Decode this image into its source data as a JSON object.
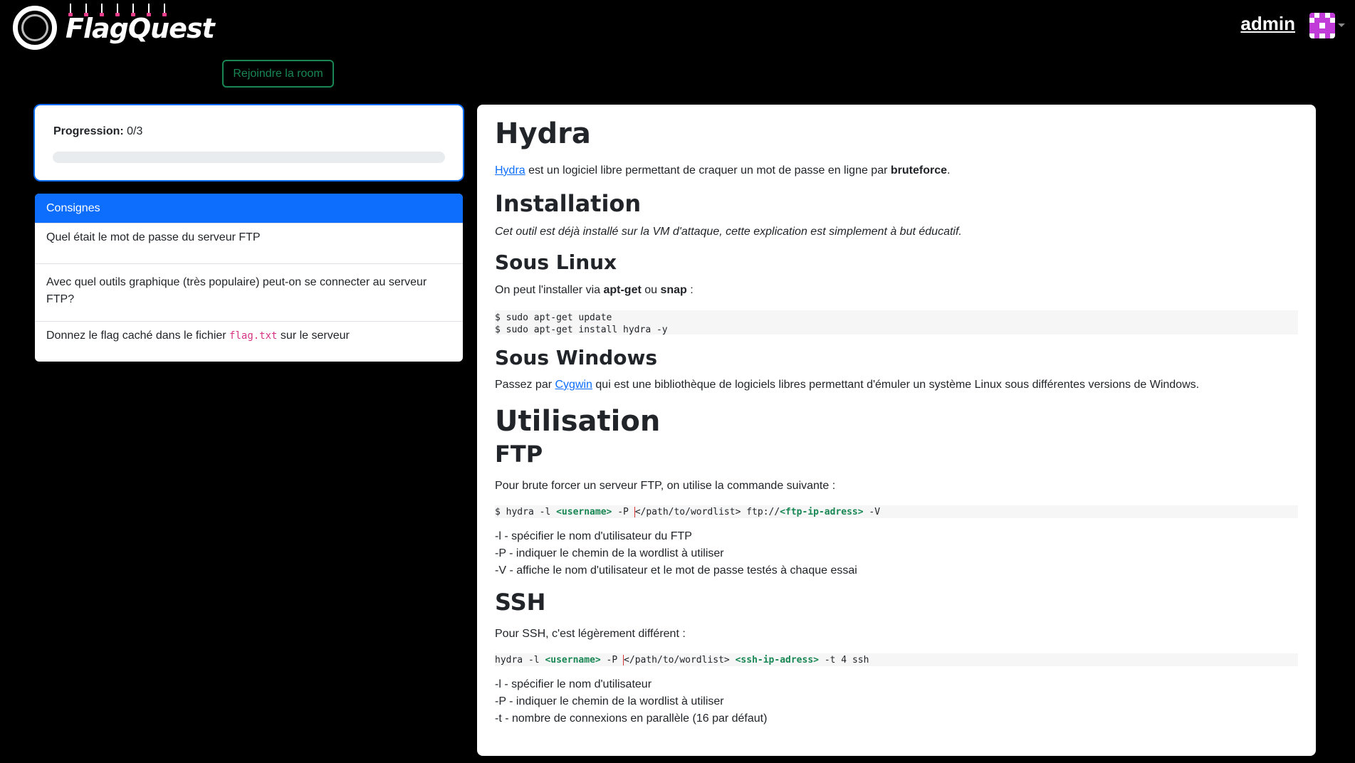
{
  "header": {
    "logo_text": "FlagQuest",
    "username": "admin"
  },
  "room": {
    "join_button": "Rejoindre la room"
  },
  "progress": {
    "label": "Progression:",
    "value_text": "0/3",
    "completed": 0,
    "total": 3
  },
  "consignes": {
    "title": "Consignes",
    "items": [
      {
        "text": "Quel était le mot de passe du serveur FTP"
      },
      {
        "text": "Avec quel outils graphique (très populaire) peut-on se connecter au serveur FTP?"
      },
      {
        "text_before": "Donnez le flag caché dans le fichier ",
        "code": "flag.txt",
        "text_after": " sur le serveur"
      }
    ]
  },
  "content": {
    "title": "Hydra",
    "intro": {
      "link": "Hydra",
      "text": " est un logiciel libre permettant de craquer un mot de passe en ligne par ",
      "bold": "bruteforce",
      "end": "."
    },
    "installation": {
      "title": "Installation",
      "note": "Cet outil est déjà installé sur la VM d'attaque, cette explication est simplement à but éducatif."
    },
    "linux": {
      "title": "Sous Linux",
      "text_before": "On peut l'installer via ",
      "bold1": "apt-get",
      "text_mid": " ou ",
      "bold2": "snap",
      "text_after": " :",
      "code_line1": "$ sudo apt-get update",
      "code_line2": "$ sudo apt-get install hydra -y"
    },
    "windows": {
      "title": "Sous Windows",
      "text_before": "Passez par ",
      "link": "Cygwin",
      "text_after": " qui est une bibliothèque de logiciels libres permettant d'émuler un système Linux sous différentes versions de Windows."
    },
    "usage": {
      "title": "Utilisation"
    },
    "ftp": {
      "title": "FTP",
      "intro": "Pour brute forcer un serveur FTP, on utilise la commande suivante :",
      "cmd_p1": "$ hydra -l ",
      "cmd_user": "<username>",
      "cmd_p2": " -P ",
      "cmd_p3": "</path/to/wordlist> ftp://",
      "cmd_ip": "<ftp-ip-adress>",
      "cmd_p4": " -V",
      "opts": [
        "-l - spécifier le nom d'utilisateur du FTP",
        "-P - indiquer le chemin de la wordlist à utiliser",
        "-V - affiche le nom d'utilisateur et le mot de passe testés à chaque essai"
      ]
    },
    "ssh": {
      "title": "SSH",
      "intro": "Pour SSH, c'est légèrement différent :",
      "cmd_p1": "hydra -l ",
      "cmd_user": "<username>",
      "cmd_p2": " -P ",
      "cmd_p3": "</path/to/wordlist> ",
      "cmd_ip": "<ssh-ip-adress>",
      "cmd_p4": " -t 4 ssh",
      "opts": [
        "-l - spécifier le nom d'utilisateur",
        "-P - indiquer le chemin de la wordlist à utiliser",
        "-t - nombre de connexions en parallèle (16 par défaut)"
      ]
    }
  },
  "colors": {
    "primary": "#0d6efd",
    "success": "#198754",
    "background": "#000000",
    "avatar": "#c03bd8"
  }
}
